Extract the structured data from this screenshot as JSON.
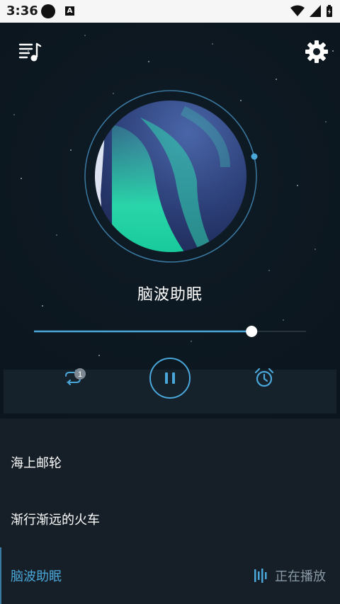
{
  "status": {
    "time": "3:36",
    "notification_letter": "A"
  },
  "header": {
    "left_icon": "playlist-music-icon",
    "right_icon": "gear-icon"
  },
  "player": {
    "title": "脑波助眠",
    "progress_fraction": 0.8,
    "repeat_badge": "1",
    "state": "playing"
  },
  "playlist": {
    "items": [
      {
        "label": "海上邮轮"
      },
      {
        "label": "渐行渐远的火车"
      },
      {
        "label": "脑波助眠"
      }
    ],
    "now_playing_label": "正在播放"
  },
  "colors": {
    "accent": "#4aa7d9",
    "background": "#101a22",
    "muted": "#8a9aa6"
  }
}
